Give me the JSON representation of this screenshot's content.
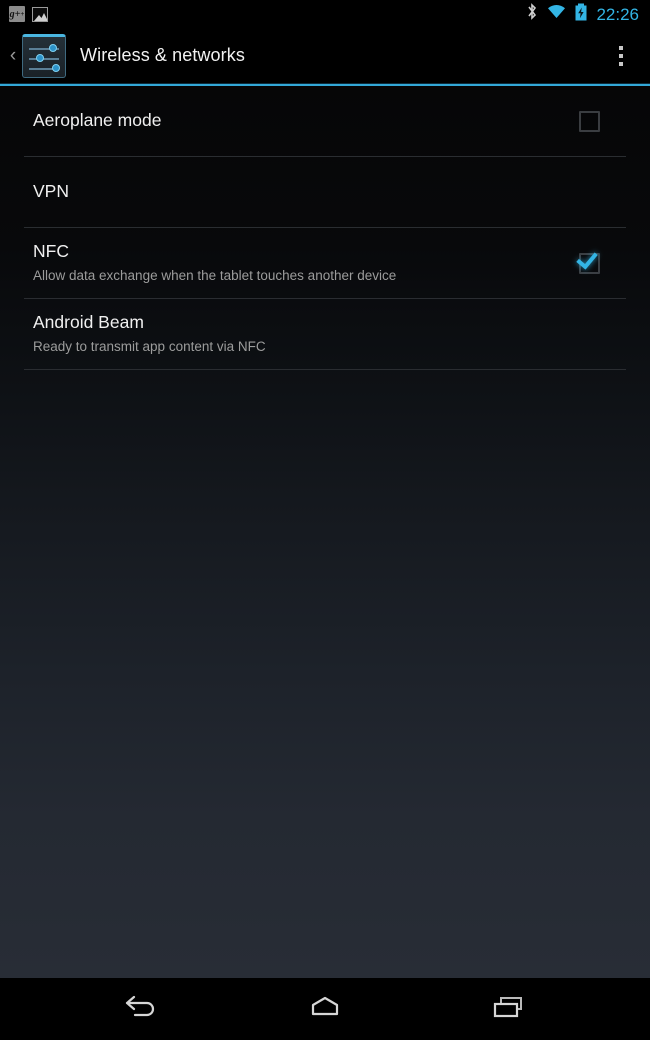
{
  "status_bar": {
    "notifications": [
      {
        "icon": "google-plus-icon",
        "label": "g+"
      },
      {
        "icon": "picture-icon",
        "label": ""
      }
    ],
    "system_icons": [
      {
        "icon": "bluetooth-icon"
      },
      {
        "icon": "wifi-icon"
      },
      {
        "icon": "battery-charging-icon"
      }
    ],
    "time": "22:26",
    "accent_color": "#33b5e5"
  },
  "action_bar": {
    "up_chevron": "‹",
    "app_icon": "settings-sliders-icon",
    "title": "Wireless & networks",
    "overflow_label": "More options",
    "underline_color": "#33a8d8"
  },
  "preferences": [
    {
      "name": "aeroplane-mode",
      "title": "Aeroplane mode",
      "summary": "",
      "has_checkbox": true,
      "checked": false
    },
    {
      "name": "vpn",
      "title": "VPN",
      "summary": "",
      "has_checkbox": false,
      "checked": false
    },
    {
      "name": "nfc",
      "title": "NFC",
      "summary": "Allow data exchange when the tablet touches another device",
      "has_checkbox": true,
      "checked": true
    },
    {
      "name": "android-beam",
      "title": "Android Beam",
      "summary": "Ready to transmit app content via NFC",
      "has_checkbox": false,
      "checked": false
    }
  ],
  "nav_bar": {
    "back_label": "Back",
    "home_label": "Home",
    "recents_label": "Recent apps"
  }
}
